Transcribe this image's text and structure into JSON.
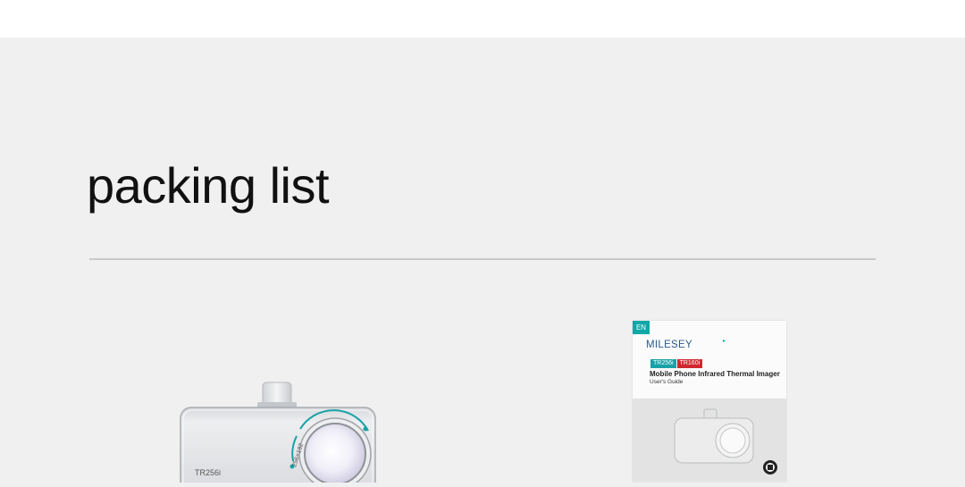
{
  "section": {
    "title": "packing list"
  },
  "device": {
    "model_text": "TR256i",
    "resolution_text": "256×192"
  },
  "manual": {
    "language": "EN",
    "brand": "MILESEY",
    "models": [
      "TR256i",
      "TR160i"
    ],
    "title": "Mobile Phone Infrared Thermal Imager",
    "subtitle": "User's Guide"
  },
  "colors": {
    "background": "#f0f0f0",
    "accent_teal": "#11a7a7",
    "accent_red": "#d0262e",
    "brand_blue": "#2c5c8c"
  }
}
